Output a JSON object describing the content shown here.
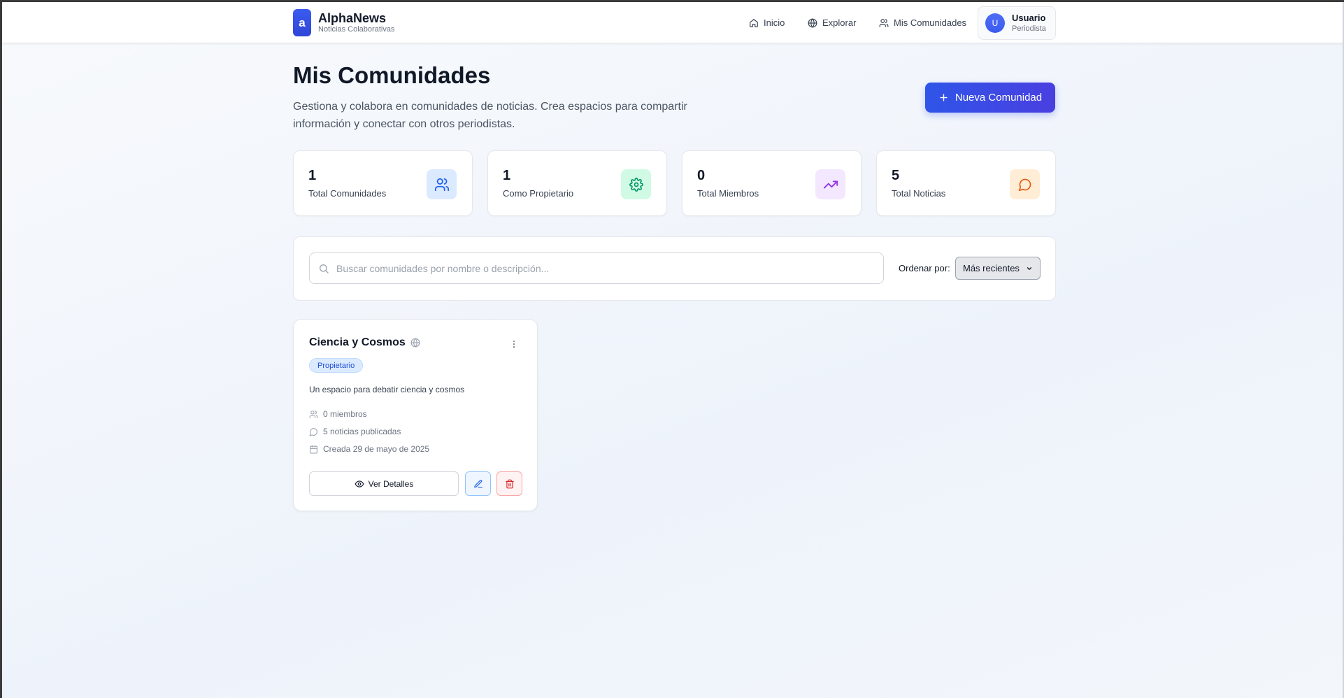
{
  "header": {
    "brand_logo": "a",
    "brand_title": "AlphaNews",
    "brand_subtitle": "Noticias Colaborativas",
    "nav": [
      {
        "label": "Inicio",
        "icon": "home-icon"
      },
      {
        "label": "Explorar",
        "icon": "globe-icon"
      },
      {
        "label": "Mis Comunidades",
        "icon": "users-icon"
      }
    ],
    "user": {
      "initial": "U",
      "name": "Usuario",
      "role": "Periodista"
    }
  },
  "page": {
    "title": "Mis Comunidades",
    "description": "Gestiona y colabora en comunidades de noticias. Crea espacios para compartir información y conectar con otros periodistas.",
    "new_button_label": "Nueva Comunidad"
  },
  "stats": [
    {
      "value": "1",
      "label": "Total Comunidades",
      "icon": "users-icon",
      "color": "#2563eb",
      "bg": "#dbeafe"
    },
    {
      "value": "1",
      "label": "Como Propietario",
      "icon": "gear-icon",
      "color": "#059669",
      "bg": "#d1fae5"
    },
    {
      "value": "0",
      "label": "Total Miembros",
      "icon": "trending-up-icon",
      "color": "#9333ea",
      "bg": "#f3e8ff"
    },
    {
      "value": "5",
      "label": "Total Noticias",
      "icon": "message-circle-icon",
      "color": "#ea580c",
      "bg": "#ffedd5"
    }
  ],
  "search": {
    "placeholder": "Buscar comunidades por nombre o descripción...",
    "value": "",
    "sort_label": "Ordenar por:",
    "sort_value": "Más recientes"
  },
  "communities": [
    {
      "name": "Ciencia y Cosmos",
      "badge": "Propietario",
      "description": "Un espacio para debatir ciencia y cosmos",
      "members": "0 miembros",
      "news": "5 noticias publicadas",
      "created": "Creada 29 de mayo de 2025",
      "view_label": "Ver Detalles"
    }
  ]
}
